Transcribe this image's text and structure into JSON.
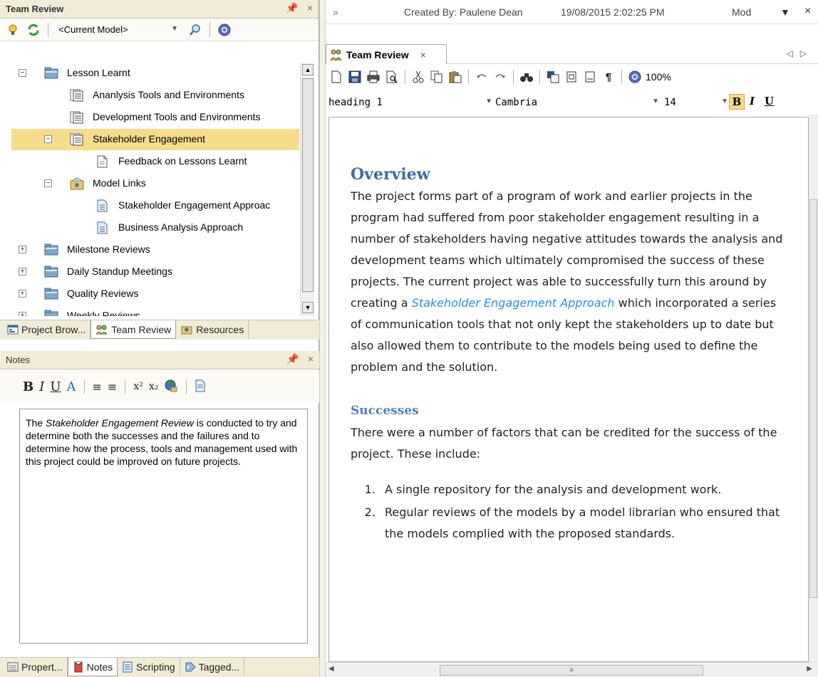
{
  "left_panel": {
    "title": "Team Review",
    "pin": "ȣ",
    "close": "×",
    "model_select": "<Current Model>",
    "tree": [
      {
        "label": "Lesson Learnt",
        "expander": "−",
        "icon": "folder-icon"
      },
      {
        "label": "Ananlysis Tools and Environments",
        "icon": "review-icon"
      },
      {
        "label": "Development Tools and Environments",
        "icon": "review-icon"
      },
      {
        "label": "Stakeholder Engagement",
        "expander": "−",
        "icon": "review-icon",
        "selected": true
      },
      {
        "label": "Feedback on Lessons Learnt",
        "icon": "document-icon"
      },
      {
        "label": "Model Links",
        "expander": "−",
        "icon": "links-icon"
      },
      {
        "label": "Stakeholder Engagement Approac",
        "icon": "artifact-icon"
      },
      {
        "label": "Business Analysis Approach",
        "icon": "artifact-icon"
      },
      {
        "label": "Milestone Reviews",
        "expander": "+",
        "icon": "folder-icon"
      },
      {
        "label": "Daily Standup Meetings",
        "expander": "+",
        "icon": "folder-icon"
      },
      {
        "label": "Quality Reviews",
        "expander": "+",
        "icon": "folder-icon"
      },
      {
        "label": "Weekly Reviews",
        "expander": "+",
        "icon": "folder-icon"
      }
    ],
    "tabs": [
      "Project Brow...",
      "Team Review",
      "Resources"
    ]
  },
  "notes_panel": {
    "title": "Notes",
    "text_before": "The ",
    "text_italic": "Stakeholder Engagement Review",
    "text_after": " is conducted to try and determine both the successes and the failures and to determine how the process, tools and management used with this project could be improved on future projects.",
    "bottom_tabs": [
      "Propert...",
      "Notes",
      "Scripting",
      "Tagged..."
    ]
  },
  "right_panel": {
    "created_by": "Created By: Paulene Dean",
    "created_date": "19/08/2015 2:02:25 PM",
    "modified": "Mod",
    "tab_label": "Team Review",
    "zoom": "100%",
    "style": "heading 1",
    "font": "Cambria",
    "size": "14"
  },
  "document": {
    "h_overview": "Overview",
    "overview_before": "The project forms part of a program of work and earlier projects in the program had suffered from poor stakeholder engagement resulting in a number of stakeholders having negative attitudes towards the analysis and development teams which ultimately compromised the success of these projects. The current project was able to successfully turn this around by creating a ",
    "overview_link": "Stakeholder Engagement Approach",
    "overview_after": " which incorporated a series of communication tools that not only kept the stakeholders up to date but also allowed them to contribute to the models being used to define the problem and the solution.",
    "h_successes": "Successes",
    "successes_text": "There were a number of factors that can be credited for the success of the project. These include:",
    "list": [
      "A single repository for the analysis and development work.",
      "Regular reviews of the models by a model librarian who ensured that the models complied with the proposed standards."
    ]
  }
}
